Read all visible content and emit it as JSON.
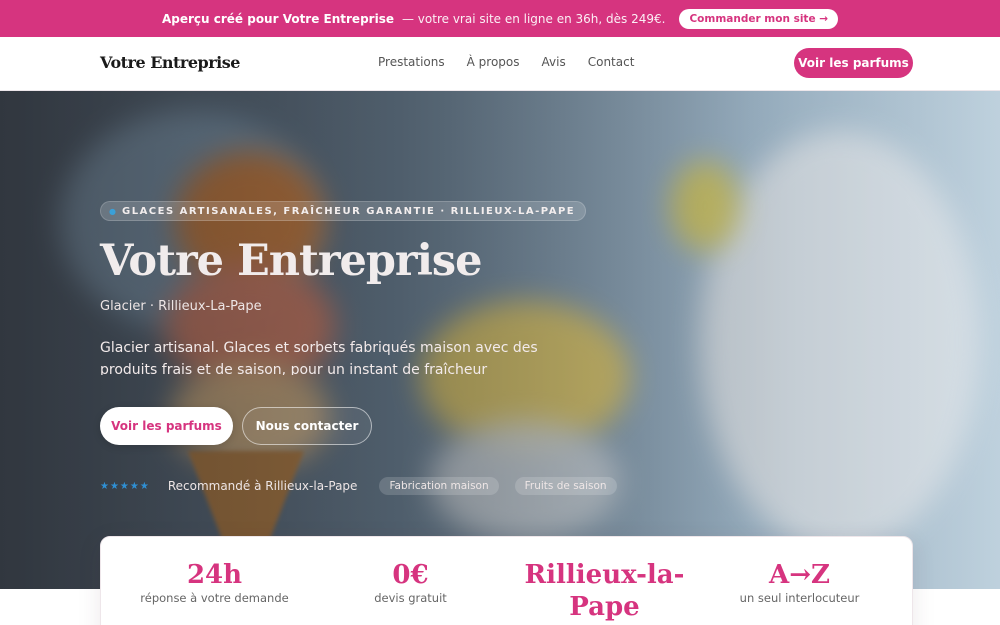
{
  "promo": {
    "text_strong": "Aperçu créé pour Votre Entreprise",
    "text_rest": "— votre vrai site en ligne en 36h, dès 249€.",
    "cta": "Commander mon site →"
  },
  "header": {
    "brand": "Votre Entreprise",
    "nav": [
      "Prestations",
      "À propos",
      "Avis",
      "Contact"
    ],
    "cta": "Voir les parfums"
  },
  "hero": {
    "tagline": "GLACES ARTISANALES, FRAÎCHEUR GARANTIE · RILLIEUX-LA-PAPE",
    "title": "Votre Entreprise",
    "subtitle": "Glacier · Rillieux-La-Pape",
    "description": "Glacier artisanal. Glaces et sorbets fabriqués maison avec des produits frais et de saison, pour un instant de fraîcheur gourmande.",
    "btn_primary": "Voir les parfums",
    "btn_secondary": "Nous contacter",
    "rating_stars": "★★★★★",
    "trust_text": "Recommandé à Rillieux-la-Pape",
    "chips": [
      "Fabrication maison",
      "Fruits de saison"
    ]
  },
  "stats": [
    {
      "value": "24h",
      "label": "réponse à votre demande"
    },
    {
      "value": "0€",
      "label": "devis gratuit"
    },
    {
      "value": "Rillieux-la-Pape",
      "label": ""
    },
    {
      "value": "A→Z",
      "label": "un seul interlocuteur"
    }
  ],
  "colors": {
    "accent": "#d6347f",
    "star": "#2f8fd3"
  }
}
